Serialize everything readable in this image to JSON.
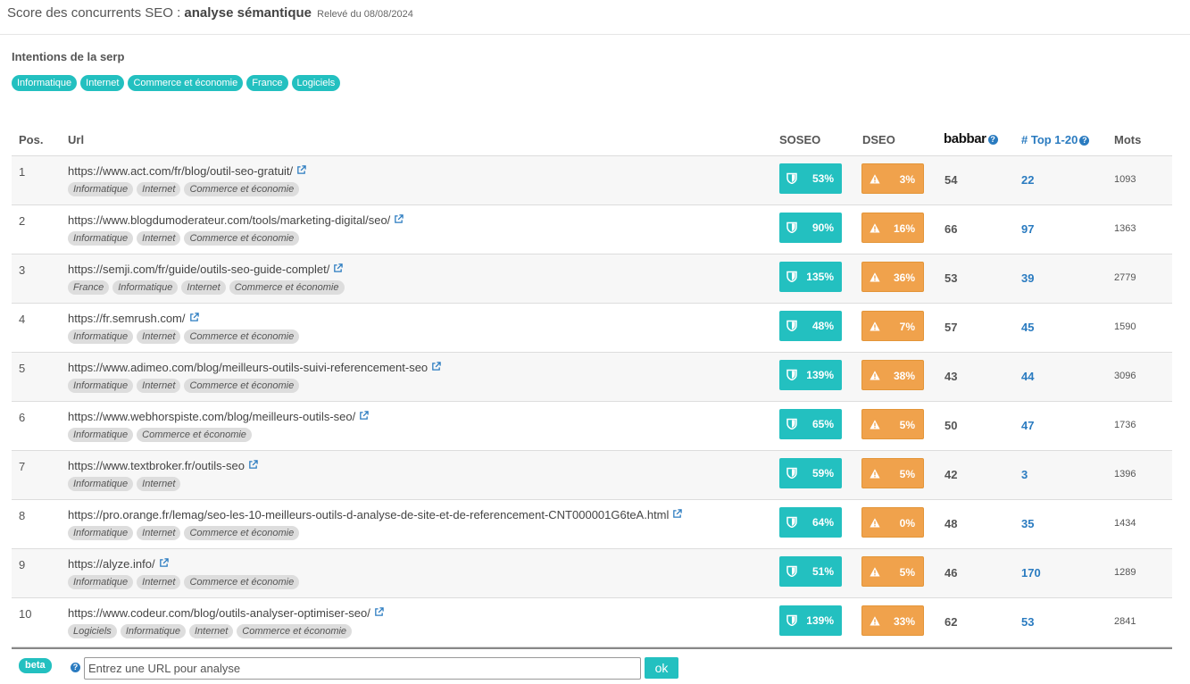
{
  "header": {
    "title_prefix": "Score des concurrents SEO : ",
    "title_bold": "analyse sémantique",
    "date": "Relevé du 08/08/2024"
  },
  "intentions": {
    "title": "Intentions de la serp",
    "tags": [
      "Informatique",
      "Internet",
      "Commerce et économie",
      "France",
      "Logiciels"
    ]
  },
  "table": {
    "headers": {
      "pos": "Pos.",
      "url": "Url",
      "soseo": "SOSEO",
      "dseo": "DSEO",
      "babbar": "babbar",
      "top": "# Top 1-20",
      "mots": "Mots"
    },
    "rows": [
      {
        "pos": "1",
        "url": "https://www.act.com/fr/blog/outil-seo-gratuit/",
        "tags": [
          "Informatique",
          "Internet",
          "Commerce et économie"
        ],
        "soseo": "53%",
        "dseo": "3%",
        "babbar": "54",
        "top": "22",
        "mots": "1093"
      },
      {
        "pos": "2",
        "url": "https://www.blogdumoderateur.com/tools/marketing-digital/seo/",
        "tags": [
          "Informatique",
          "Internet",
          "Commerce et économie"
        ],
        "soseo": "90%",
        "dseo": "16%",
        "babbar": "66",
        "top": "97",
        "mots": "1363"
      },
      {
        "pos": "3",
        "url": "https://semji.com/fr/guide/outils-seo-guide-complet/",
        "tags": [
          "France",
          "Informatique",
          "Internet",
          "Commerce et économie"
        ],
        "soseo": "135%",
        "dseo": "36%",
        "babbar": "53",
        "top": "39",
        "mots": "2779"
      },
      {
        "pos": "4",
        "url": "https://fr.semrush.com/",
        "tags": [
          "Informatique",
          "Internet",
          "Commerce et économie"
        ],
        "soseo": "48%",
        "dseo": "7%",
        "babbar": "57",
        "top": "45",
        "mots": "1590"
      },
      {
        "pos": "5",
        "url": "https://www.adimeo.com/blog/meilleurs-outils-suivi-referencement-seo",
        "tags": [
          "Informatique",
          "Internet",
          "Commerce et économie"
        ],
        "soseo": "139%",
        "dseo": "38%",
        "babbar": "43",
        "top": "44",
        "mots": "3096"
      },
      {
        "pos": "6",
        "url": "https://www.webhorspiste.com/blog/meilleurs-outils-seo/",
        "tags": [
          "Informatique",
          "Commerce et économie"
        ],
        "soseo": "65%",
        "dseo": "5%",
        "babbar": "50",
        "top": "47",
        "mots": "1736"
      },
      {
        "pos": "7",
        "url": "https://www.textbroker.fr/outils-seo",
        "tags": [
          "Informatique",
          "Internet"
        ],
        "soseo": "59%",
        "dseo": "5%",
        "babbar": "42",
        "top": "3",
        "mots": "1396"
      },
      {
        "pos": "8",
        "url": "https://pro.orange.fr/lemag/seo-les-10-meilleurs-outils-d-analyse-de-site-et-de-referencement-CNT000001G6teA.html",
        "tags": [
          "Informatique",
          "Internet",
          "Commerce et économie"
        ],
        "soseo": "64%",
        "dseo": "0%",
        "babbar": "48",
        "top": "35",
        "mots": "1434"
      },
      {
        "pos": "9",
        "url": "https://alyze.info/",
        "tags": [
          "Informatique",
          "Internet",
          "Commerce et économie"
        ],
        "soseo": "51%",
        "dseo": "5%",
        "babbar": "46",
        "top": "170",
        "mots": "1289"
      },
      {
        "pos": "10",
        "url": "https://www.codeur.com/blog/outils-analyser-optimiser-seo/",
        "tags": [
          "Logiciels",
          "Informatique",
          "Internet",
          "Commerce et économie"
        ],
        "soseo": "139%",
        "dseo": "33%",
        "babbar": "62",
        "top": "53",
        "mots": "2841"
      }
    ]
  },
  "footer": {
    "beta_label": "beta",
    "input_placeholder": "Entrez une URL pour analyse",
    "ok_label": "ok"
  },
  "colors": {
    "teal": "#23c0c0",
    "orange": "#f0a24c",
    "blue_link": "#2a7bc0"
  },
  "icons": [
    "external-link-icon",
    "shield-icon",
    "warning-icon",
    "help-icon"
  ]
}
